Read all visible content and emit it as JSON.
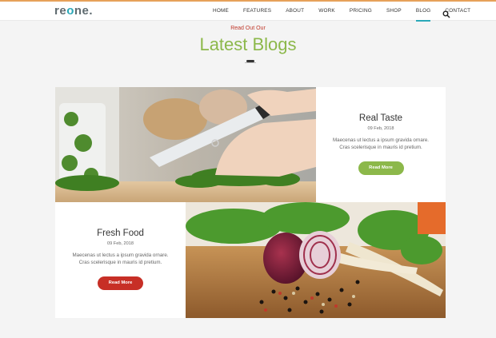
{
  "header": {
    "logo_prefix": "re",
    "logo_o": "o",
    "logo_suffix": "ne.",
    "nav": [
      "HOME",
      "FEATURES",
      "ABOUT",
      "WORK",
      "PRICING",
      "SHOP",
      "BLOG",
      "CONTACT"
    ],
    "active_nav": "BLOG",
    "search_icon": "search-icon"
  },
  "section": {
    "kicker": "Read Out Our",
    "title": "Latest Blogs"
  },
  "posts": [
    {
      "title": "Real Taste",
      "date": "09 Feb, 2018",
      "excerpt_line1": "Maecenas ut lectus a ipsum gravida ornare.",
      "excerpt_line2": "Cras scelerisque in mauris id pretium.",
      "button": "Read More",
      "button_color": "#8cb84a",
      "image": "chopping-herbs-photo"
    },
    {
      "title": "Fresh Food",
      "date": "09 Feb, 2018",
      "excerpt_line1": "Maecenas ut lectus a ipsum gravida ornare.",
      "excerpt_line2": "Cras scelerisque in mauris id pretium.",
      "button": "Read More",
      "button_color": "#c72f26",
      "image": "red-onion-vegetables-photo"
    }
  ],
  "colors": {
    "accent_green": "#8cb84a",
    "accent_teal": "#2aa8b8",
    "accent_red": "#c72f26",
    "top_line": "#e6a15a"
  }
}
